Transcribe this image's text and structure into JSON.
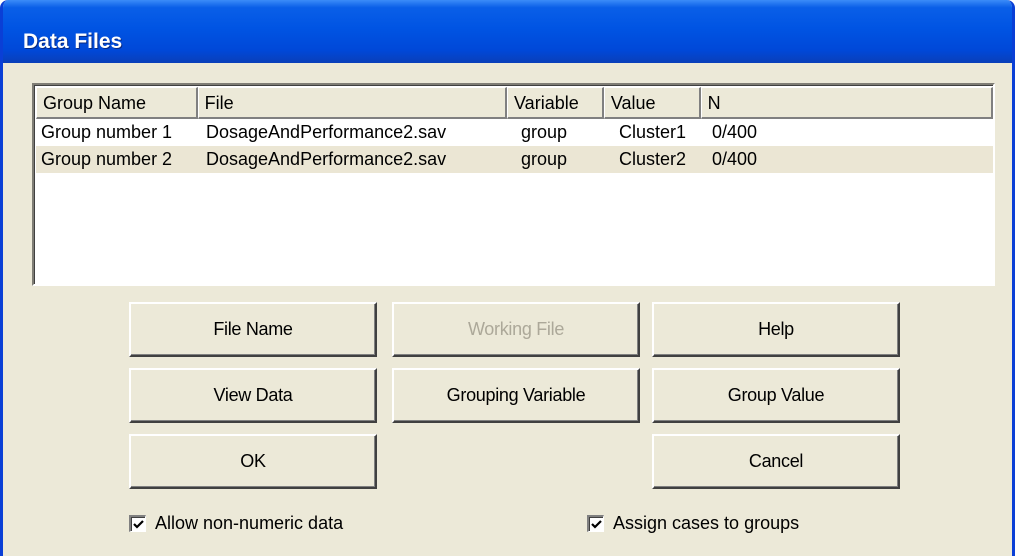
{
  "window": {
    "title": "Data Files"
  },
  "list": {
    "columns": [
      "Group Name",
      "File",
      "Variable",
      "Value",
      "N"
    ],
    "rows": [
      [
        "Group number 1",
        "DosageAndPerformance2.sav",
        "group",
        "Cluster1",
        "0/400"
      ],
      [
        "Group number 2",
        "DosageAndPerformance2.sav",
        "group",
        "Cluster2",
        "0/400"
      ]
    ]
  },
  "buttons": {
    "file_name": "File Name",
    "working_file": "Working File",
    "help": "Help",
    "view_data": "View Data",
    "grouping_variable": "Grouping Variable",
    "group_value": "Group Value",
    "ok": "OK",
    "cancel": "Cancel"
  },
  "options": {
    "allow_non_numeric": {
      "label": "Allow non-numeric data",
      "checked": true
    },
    "assign_cases": {
      "label": "Assign cases to groups",
      "checked": true
    }
  }
}
